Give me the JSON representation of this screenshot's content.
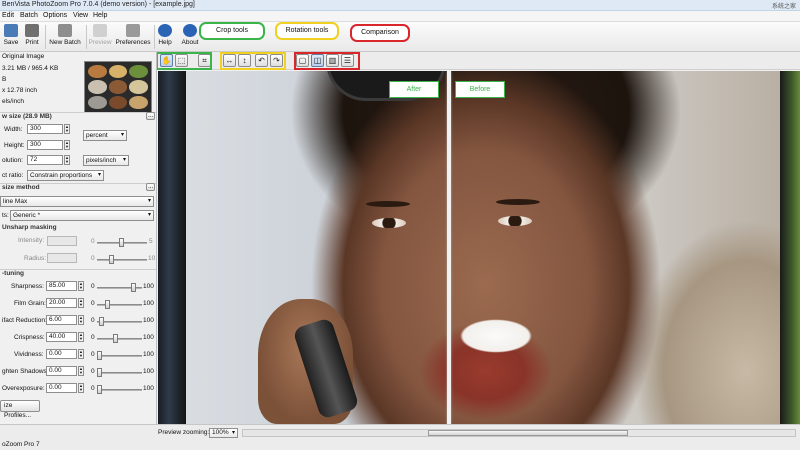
{
  "window": {
    "title": "BenVista PhotoZoom Pro 7.0.4 (demo version) - [example.jpg]",
    "brand": "系统之家"
  },
  "menu": [
    "Edit",
    "Batch",
    "Options",
    "View",
    "Help"
  ],
  "toolbar": {
    "save": "Save",
    "print": "Print",
    "new_batch": "New Batch",
    "preview": "Preview",
    "preferences": "Preferences",
    "help": "Help",
    "about": "About"
  },
  "callouts": {
    "crop": "Crop tools",
    "rotation": "Rotation tools",
    "comparison": "Comparison"
  },
  "colors": {
    "green": "#3bb44a",
    "yellow": "#f0d020",
    "red": "#d9262b"
  },
  "left": {
    "original_image": "Original Image",
    "orig_size": "3.21 MB / 965.4 KB",
    "orig_unit": "B",
    "orig_dims": "x 12.78 inch",
    "orig_res": "els/inch",
    "new_size": "w size (28.9 MB)",
    "width_label": "Width:",
    "width_value": "300",
    "width_unit": "percent",
    "height_label": "Height:",
    "height_value": "300",
    "resolution_label": "olution:",
    "resolution_value": "72",
    "resolution_unit": "pixels/inch",
    "aspect_label": "ct ratio:",
    "aspect_value": "Constrain proportions",
    "resize_method": "size method",
    "method_value": "line Max",
    "presets_label": "ts:",
    "presets_value": "Generic *",
    "unsharp": "Unsharp masking",
    "intensity_label": "Intensity:",
    "intensity_min": "0",
    "intensity_max": "5",
    "radius_label": "Radius:",
    "radius_min": "0",
    "radius_max": "10",
    "finetuning": "-tuning",
    "sharpness_label": "Sharpness:",
    "sharpness_value": "85.00",
    "sharpness_level": 0.85,
    "filmgrain_label": "Film Grain:",
    "filmgrain_value": "20.00",
    "filmgrain_level": 0.2,
    "artifact_label": "ifact Reduction:",
    "artifact_value": "6.00",
    "artifact_level": 0.06,
    "crispness_label": "Crispness:",
    "crispness_value": "40.00",
    "crispness_level": 0.4,
    "vividness_label": "Vividness:",
    "vividness_value": "0.00",
    "vividness_level": 0,
    "shadows_label": "ghten Shadows:",
    "shadows_value": "0.00",
    "shadows_level": 0,
    "overexposure_label": "Overexposure:",
    "overexposure_value": "0.00",
    "overexposure_level": 0,
    "slider_min": "0",
    "slider_max": "100",
    "profiles_button": "ize Profiles...",
    "more_button": "..."
  },
  "viewer": {
    "after": "After",
    "before": "Before"
  },
  "status": {
    "app": "oZoom Pro 7",
    "preview_zoom_label": "Preview zooming:",
    "zoom_value": "100%"
  }
}
